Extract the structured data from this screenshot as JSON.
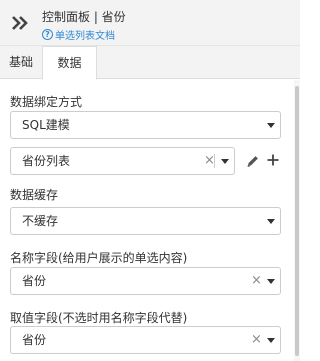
{
  "header": {
    "title": "控制面板 | 省份",
    "doc_link": "单选列表文档",
    "collapse_icon": "double-chevron-right-icon"
  },
  "tabs": [
    {
      "label": "基础",
      "active": false
    },
    {
      "label": "数据",
      "active": true
    }
  ],
  "form": {
    "binding_label": "数据绑定方式",
    "binding_value": "SQL建模",
    "model_value": "省份列表",
    "cache_label": "数据缓存",
    "cache_value": "不缓存",
    "name_field_label": "名称字段(给用户展示的单选内容)",
    "name_field_value": "省份",
    "value_field_label": "取值字段(不选时用名称字段代替)",
    "value_field_value": "省份"
  },
  "colors": {
    "link": "#2f89d7",
    "header_bg": "#f3f3f3"
  }
}
